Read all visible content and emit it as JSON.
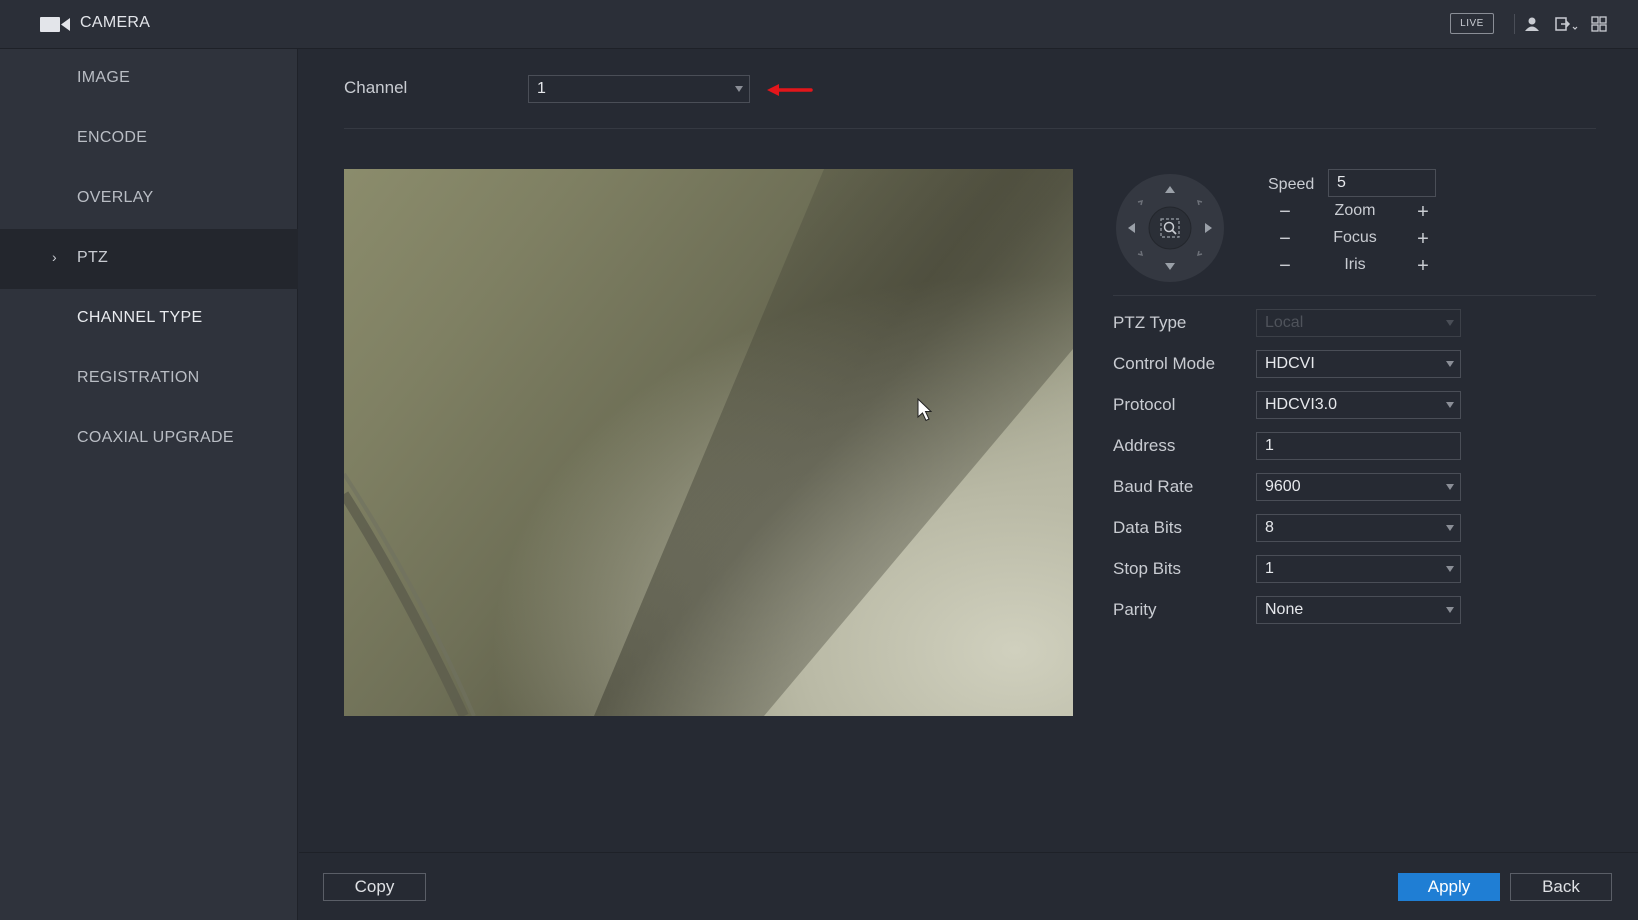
{
  "app": {
    "title": "CAMERA",
    "live_label": "LIVE"
  },
  "sidebar": {
    "items": [
      {
        "label": "IMAGE"
      },
      {
        "label": "ENCODE"
      },
      {
        "label": "OVERLAY"
      },
      {
        "label": "PTZ",
        "active": true
      },
      {
        "label": "CHANNEL TYPE"
      },
      {
        "label": "REGISTRATION"
      },
      {
        "label": "COAXIAL UPGRADE"
      }
    ]
  },
  "channel": {
    "label": "Channel",
    "value": "1"
  },
  "ptz_controls": {
    "speed_label": "Speed",
    "speed_value": "5",
    "zoom_label": "Zoom",
    "focus_label": "Focus",
    "iris_label": "Iris",
    "minus": "−",
    "plus": "+"
  },
  "form": {
    "ptz_type": {
      "label": "PTZ Type",
      "value": "Local"
    },
    "control_mode": {
      "label": "Control Mode",
      "value": "HDCVI"
    },
    "protocol": {
      "label": "Protocol",
      "value": "HDCVI3.0"
    },
    "address": {
      "label": "Address",
      "value": "1"
    },
    "baud_rate": {
      "label": "Baud Rate",
      "value": "9600"
    },
    "data_bits": {
      "label": "Data Bits",
      "value": "8"
    },
    "stop_bits": {
      "label": "Stop Bits",
      "value": "1"
    },
    "parity": {
      "label": "Parity",
      "value": "None"
    }
  },
  "footer": {
    "copy_label": "Copy",
    "apply_label": "Apply",
    "back_label": "Back"
  },
  "colors": {
    "accent": "#1f7ed4",
    "arrow": "#e3161b",
    "background": "#262a33",
    "sidebar": "#2f333c"
  }
}
